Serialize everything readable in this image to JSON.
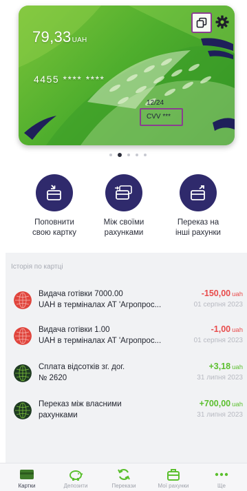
{
  "card": {
    "balance_amount": "79,33",
    "balance_currency": "UAH",
    "number_masked": "4455 **** ****",
    "expiry": "12/24",
    "cvv_label": "CVV ***",
    "copy_icon": "copy-icon",
    "settings_icon": "gear-icon",
    "accent_color": "#8a3d8f"
  },
  "pager": {
    "count": 5,
    "active_index": 1
  },
  "actions": [
    {
      "label_line1": "Поповнити",
      "label_line2": "свою картку",
      "icon": "card-topup-icon"
    },
    {
      "label_line1": "Між своїми",
      "label_line2": "рахунками",
      "icon": "card-transfer-own-icon"
    },
    {
      "label_line1": "Переказ на",
      "label_line2": "інші рахунки",
      "icon": "card-send-icon"
    }
  ],
  "history": {
    "title": "Історія по картці",
    "items": [
      {
        "line1": "Видача готівки 7000.00",
        "line2": "UAH в терміналах АТ 'Агропрос...",
        "amount": "-150,00",
        "currency": "uah",
        "date": "01 серпня 2023",
        "type": "negative",
        "icon": "red-globe-icon"
      },
      {
        "line1": "Видача готівки 1.00",
        "line2": "UAH в терміналах АТ 'Агропрос...",
        "amount": "-1,00",
        "currency": "uah",
        "date": "01 серпня 2023",
        "type": "negative",
        "icon": "red-globe-icon"
      },
      {
        "line1": "Сплата відсотків зг. дог.",
        "line2": "№ 2620",
        "amount": "+3,18",
        "currency": "uah",
        "date": "31 липня 2023",
        "type": "positive",
        "icon": "dark-green-globe-icon"
      },
      {
        "line1": "Переказ між власними",
        "line2": "рахунками",
        "amount": "+700,00",
        "currency": "uah",
        "date": "31 липня 2023",
        "type": "positive",
        "icon": "dark-green-globe-icon"
      }
    ]
  },
  "bottom_nav": [
    {
      "label": "Картки",
      "icon": "card-icon",
      "active": true
    },
    {
      "label": "Депозити",
      "icon": "piggy-bank-icon",
      "active": false
    },
    {
      "label": "Перекази",
      "icon": "refresh-arrows-icon",
      "active": false
    },
    {
      "label": "Мої рахунки",
      "icon": "briefcase-icon",
      "active": false
    },
    {
      "label": "Ще",
      "icon": "more-dots-icon",
      "active": false
    }
  ],
  "colors": {
    "brand_dark": "#2f2a6c",
    "negative": "#e84b4b",
    "positive": "#5bbf2e",
    "card_green": "#4fae2d"
  }
}
